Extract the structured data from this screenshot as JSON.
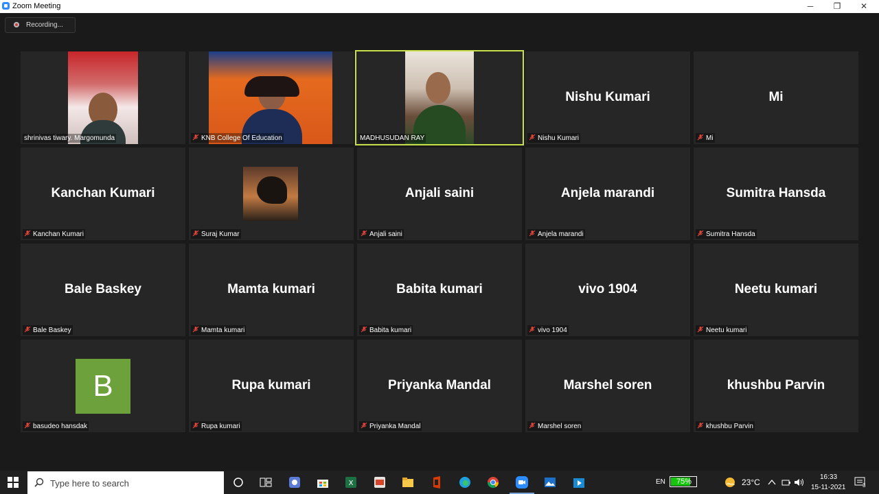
{
  "window": {
    "title": "Zoom Meeting",
    "controls": {
      "minimize": "─",
      "maximize": "❐",
      "close": "✕"
    }
  },
  "recording": {
    "label": "Recording..."
  },
  "participants": [
    {
      "caption": "shrinivas tiwary. Margomunda",
      "big": "",
      "video": true,
      "muted": false
    },
    {
      "caption": "KNB College Of Education",
      "big": "",
      "video": true,
      "muted": true
    },
    {
      "caption": "MADHUSUDAN RAY",
      "big": "",
      "video": true,
      "muted": false,
      "active": true
    },
    {
      "caption": "Nishu Kumari",
      "big": "Nishu Kumari",
      "muted": true
    },
    {
      "caption": "Mi",
      "big": "Mi",
      "muted": true
    },
    {
      "caption": "Kanchan Kumari",
      "big": "Kanchan Kumari",
      "muted": true
    },
    {
      "caption": "Suraj Kumar",
      "big": "",
      "muted": true
    },
    {
      "caption": "Anjali saini",
      "big": "Anjali saini",
      "muted": true
    },
    {
      "caption": "Anjela marandi",
      "big": "Anjela marandi",
      "muted": true
    },
    {
      "caption": "Sumitra Hansda",
      "big": "Sumitra Hansda",
      "muted": true
    },
    {
      "caption": "Bale Baskey",
      "big": "Bale Baskey",
      "muted": true
    },
    {
      "caption": "Mamta kumari",
      "big": "Mamta kumari",
      "muted": true
    },
    {
      "caption": "Babita kumari",
      "big": "Babita kumari",
      "muted": true
    },
    {
      "caption": "vivo 1904",
      "big": "vivo 1904",
      "muted": true
    },
    {
      "caption": "Neetu kumari",
      "big": "Neetu kumari",
      "muted": true
    },
    {
      "caption": "basudeo hansdak",
      "big": "",
      "avatar_letter": "B",
      "muted": true
    },
    {
      "caption": "Rupa kumari",
      "big": "Rupa kumari",
      "muted": true
    },
    {
      "caption": "Priyanka Mandal",
      "big": "Priyanka Mandal",
      "muted": true
    },
    {
      "caption": "Marshel soren",
      "big": "Marshel soren",
      "muted": true
    },
    {
      "caption": "khushbu Parvin",
      "big": "khushbu Parvin",
      "muted": true
    }
  ],
  "taskbar": {
    "search_placeholder": "Type here to search",
    "language": "EN",
    "battery": "75%",
    "temperature": "23°C",
    "time": "16:33",
    "date": "15-11-2021",
    "notification_count": "3"
  },
  "colors": {
    "active_speaker": "#c8e04a",
    "muted_icon": "#e0453a",
    "avatar_bg": "#6da13b",
    "tile_bg": "#262626"
  }
}
